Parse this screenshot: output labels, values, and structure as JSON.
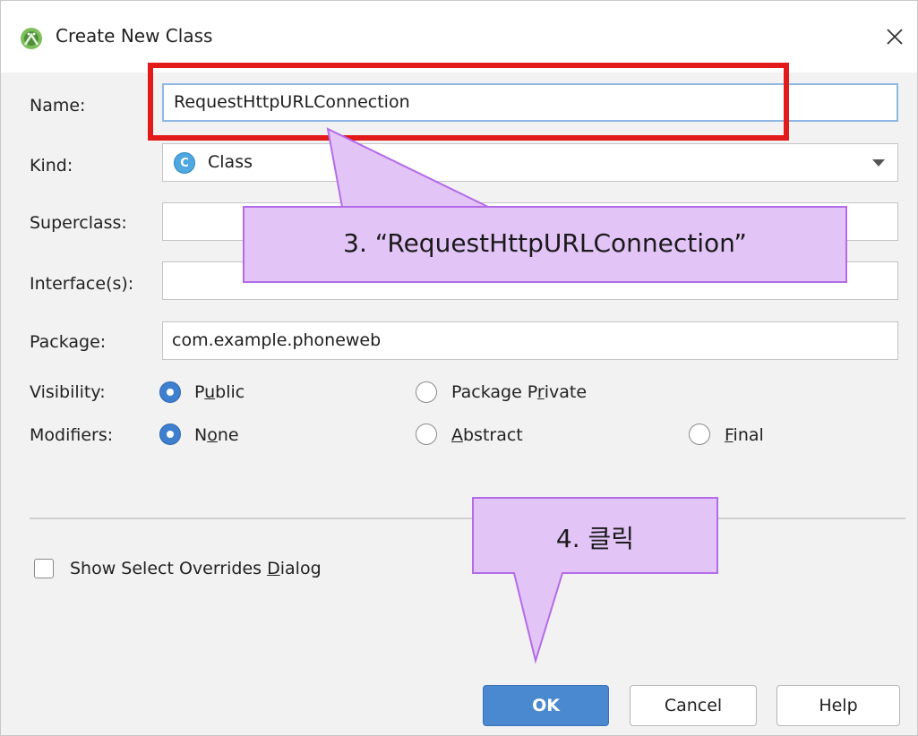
{
  "dialog": {
    "title": "Create New Class",
    "icons": {
      "app": "android-studio-icon",
      "close": "close-icon"
    }
  },
  "form": {
    "name": {
      "label": "Name:",
      "value": "RequestHttpURLConnection"
    },
    "kind": {
      "label": "Kind:",
      "badge": "C",
      "value": "Class"
    },
    "superclass": {
      "label": "Superclass:",
      "value": ""
    },
    "interfaces": {
      "label": "Interface(s):",
      "value": ""
    },
    "package": {
      "label": "Package:",
      "value": "com.example.phoneweb"
    },
    "visibility": {
      "label": "Visibility:",
      "options": [
        {
          "pre": "P",
          "mnemonic": "u",
          "post": "blic",
          "selected": true
        },
        {
          "pre": "Package P",
          "mnemonic": "r",
          "post": "ivate",
          "selected": false
        }
      ]
    },
    "modifiers": {
      "label": "Modifiers:",
      "options": [
        {
          "pre": "N",
          "mnemonic": "o",
          "post": "ne",
          "selected": true
        },
        {
          "pre": "",
          "mnemonic": "A",
          "post": "bstract",
          "selected": false
        },
        {
          "pre": "",
          "mnemonic": "F",
          "post": "inal",
          "selected": false
        }
      ]
    },
    "show_overrides": {
      "pre": "Show Select Overrides ",
      "mnemonic": "D",
      "post": "ialog",
      "checked": false
    }
  },
  "buttons": {
    "ok": "OK",
    "cancel": "Cancel",
    "help": "Help"
  },
  "annotations": {
    "step3": "3. “RequestHttpURLConnection”",
    "step4": "4. 클릭"
  },
  "colors": {
    "highlight_border": "#e21a1a",
    "callout_fill": "#e3c4f7",
    "callout_stroke": "#b46be8",
    "primary_button": "#4a88cf"
  }
}
